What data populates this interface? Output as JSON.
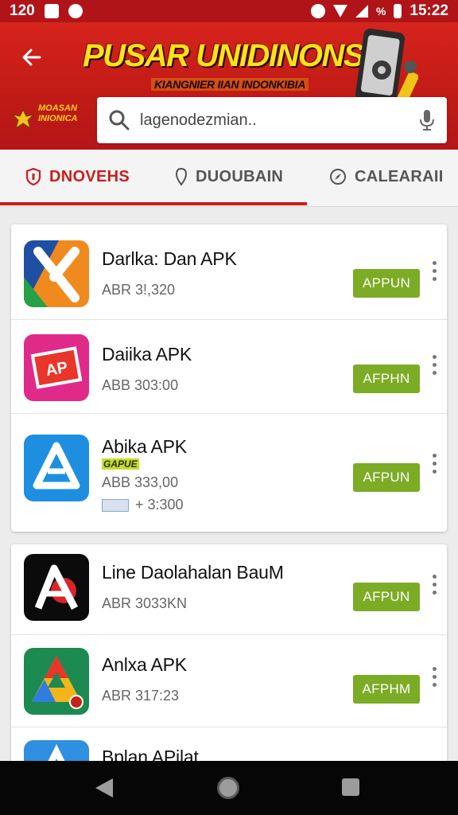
{
  "status_bar": {
    "left_text": "120",
    "battery_pct_symbol": "%",
    "time": "15:22"
  },
  "header": {
    "title": "PUSAR UNIDINONSIA",
    "subtitle": "KIANGNIER IIAN INDONKIBIA",
    "logo_text_line1": "MOASAN",
    "logo_text_line2": "INIONICA",
    "search": {
      "value": "lagenodezmian..",
      "placeholder": "lagenodezmian.."
    },
    "brand_red": "#c8201c",
    "brand_yellow": "#ffe11a"
  },
  "tabs": [
    {
      "label": "DNOVEHS",
      "icon": "shield-icon",
      "active": true
    },
    {
      "label": "DUOUBAIN",
      "icon": "pin-icon",
      "active": false
    },
    {
      "label": "CALEARAII",
      "icon": "compass-icon",
      "active": false
    }
  ],
  "cards": [
    {
      "apps": [
        {
          "name": "Darlka: Dan APK",
          "meta": "ABR 3!,320",
          "button": "APPUN",
          "icon": "x-app-icon"
        },
        {
          "name": "Daiika APK",
          "meta": "ABB 303:00",
          "button": "AFPHN",
          "icon": "ap-app-icon"
        },
        {
          "name": "Abika APK",
          "tag": "GAPUE",
          "meta": "ABB 333,00",
          "extra": "+ 3:300",
          "button": "AFPUN",
          "icon": "triangle-app-icon"
        }
      ]
    },
    {
      "apps": [
        {
          "name": "Line Daolahalan BauM",
          "meta": "ABR 3033KN",
          "button": "AFPUN",
          "icon": "a-letter-app-icon"
        },
        {
          "name": "Anlxa APK",
          "meta": "ABR 317:23",
          "button": "AFPHM",
          "icon": "drive-app-icon"
        },
        {
          "name": "Bplan APilat",
          "icon": "partial-app-icon"
        }
      ]
    }
  ],
  "colors": {
    "install_green": "#7cab25",
    "nav_bar": "#060606"
  }
}
